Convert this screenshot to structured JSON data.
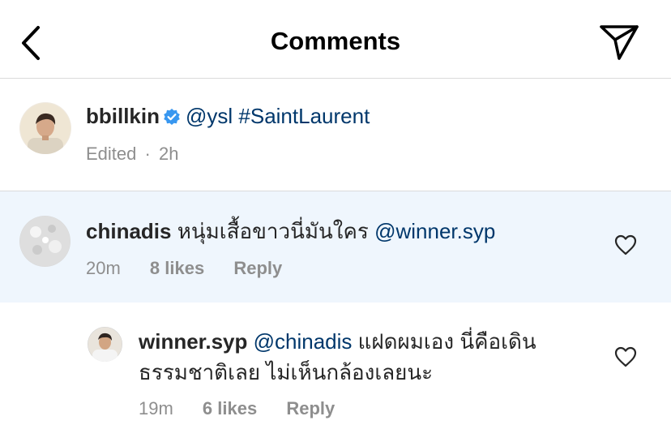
{
  "header": {
    "title": "Comments",
    "back_icon": "chevron-left-icon",
    "share_icon": "paper-plane-icon"
  },
  "caption": {
    "username": "bbillkin",
    "verified": true,
    "text": "@ysl #SaintLaurent",
    "edited": "Edited",
    "separator": "·",
    "time": "2h"
  },
  "comments": [
    {
      "username": "chinadis",
      "text": "หนุ่มเสื้อขาวนี่มันใคร",
      "mention": "@winner.syp",
      "time": "20m",
      "likes": "8 likes",
      "reply": "Reply",
      "highlighted": true
    },
    {
      "username": "winner.syp",
      "mention": "@chinadis",
      "text_line1": "แฝดผมเอง นี่คือเดิน",
      "text_line2": "ธรรมชาติเลย ไม่เห็นกล้องเลยนะ",
      "time": "19m",
      "likes": "6 likes",
      "reply": "Reply"
    }
  ],
  "colors": {
    "highlight_bg": "#eff6fd",
    "link": "#00376b",
    "meta": "#8e8e8e",
    "verified": "#3897f0"
  }
}
